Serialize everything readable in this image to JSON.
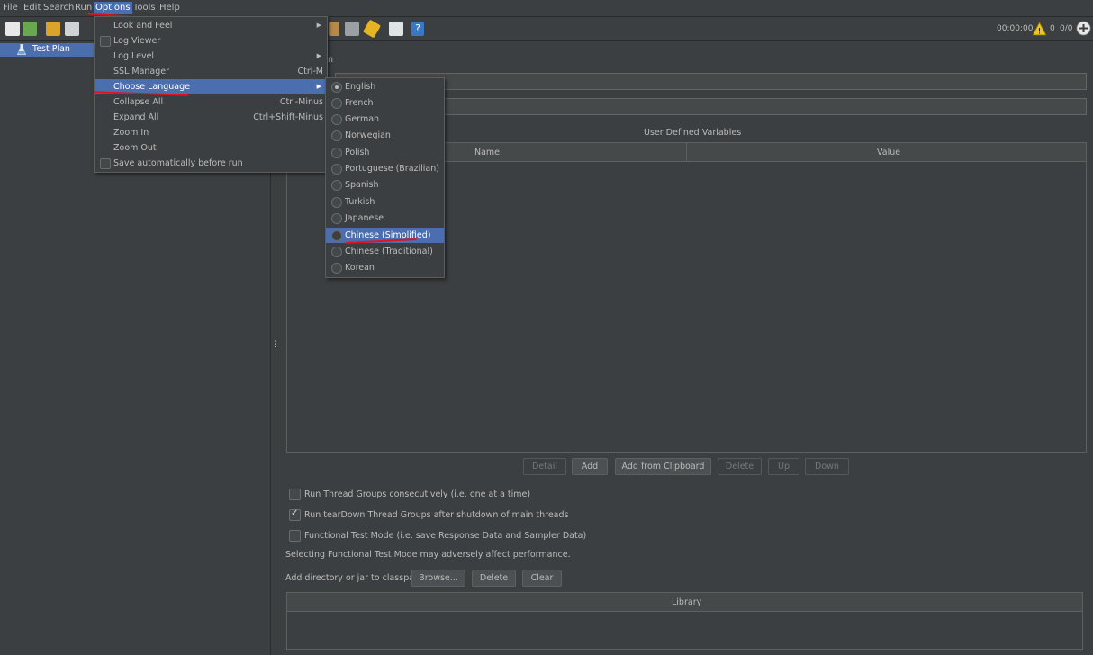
{
  "menubar": [
    "File",
    "Edit",
    "Search",
    "Run",
    "Options",
    "Tools",
    "Help"
  ],
  "tree": {
    "root": "Test Plan"
  },
  "status": {
    "timer": "00:00:00",
    "warnings": "0",
    "threads": "0/0"
  },
  "panel": {
    "partial_label": "n",
    "variables_title": "User Defined Variables",
    "col_name": "Name:",
    "col_value": "Value",
    "buttons": {
      "detail": "Detail",
      "add": "Add",
      "add_clip": "Add from Clipboard",
      "delete": "Delete",
      "up": "Up",
      "down": "Down"
    },
    "cb_consecutive": "Run Thread Groups consecutively (i.e. one at a time)",
    "cb_teardown": "Run tearDown Thread Groups after shutdown of main threads",
    "cb_functional": "Functional Test Mode (i.e. save Response Data and Sampler Data)",
    "warning": "Selecting Functional Test Mode may adversely affect performance.",
    "classpath_label": "Add directory or jar to classpath",
    "browse": "Browse...",
    "cp_delete": "Delete",
    "cp_clear": "Clear",
    "library_header": "Library"
  },
  "options_menu": {
    "look_feel": "Look and Feel",
    "log_viewer": "Log Viewer",
    "log_level": "Log Level",
    "ssl_manager": "SSL Manager",
    "ssl_shortcut": "Ctrl-M",
    "choose_language": "Choose Language",
    "collapse_all": "Collapse All",
    "collapse_shortcut": "Ctrl-Minus",
    "expand_all": "Expand All",
    "expand_shortcut": "Ctrl+Shift-Minus",
    "zoom_in": "Zoom In",
    "zoom_out": "Zoom Out",
    "save_auto": "Save automatically before run"
  },
  "languages": [
    "English",
    "French",
    "German",
    "Norwegian",
    "Polish",
    "Portuguese (Brazilian)",
    "Spanish",
    "Turkish",
    "Japanese",
    "Chinese (Simplified)",
    "Chinese (Traditional)",
    "Korean"
  ],
  "colors": {
    "accent": "#4b6eaf",
    "background": "#3c3f41",
    "annotation": "#e0141e"
  }
}
